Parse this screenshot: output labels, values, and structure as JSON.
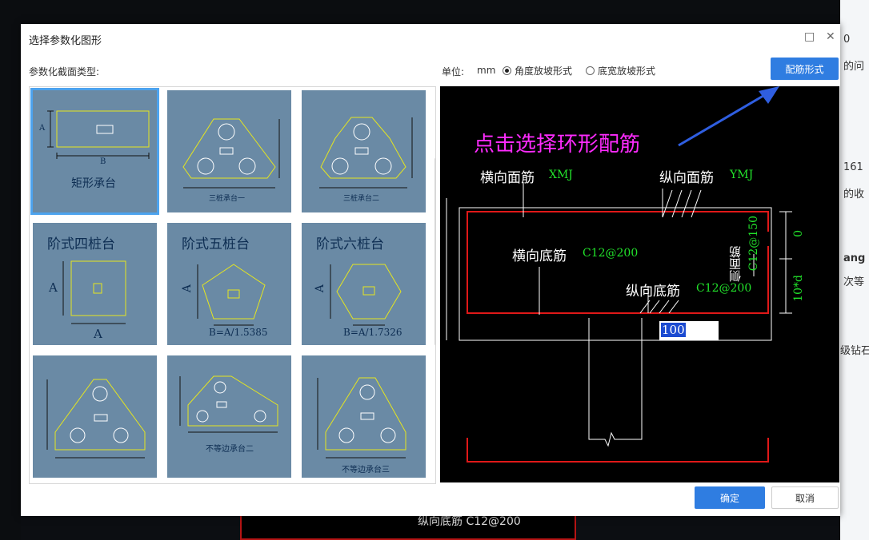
{
  "background": {
    "right_texts": [
      "0",
      "的问",
      "161",
      "的收",
      "ang",
      "次等",
      "级钻石"
    ],
    "cad_text": "纵向底筋 C12@200"
  },
  "dialog": {
    "title": "选择参数化图形",
    "section_label": "参数化截面类型:",
    "unit_label": "单位:",
    "unit_value": "mm",
    "radio_angle": "角度放坡形式",
    "radio_width": "底宽放坡形式",
    "rebar_button": "配筋形式",
    "ok_button": "确定",
    "cancel_button": "取消"
  },
  "gallery": [
    {
      "label": "矩形承台",
      "dim_a": "A",
      "dim_b": "B",
      "selected": true
    },
    {
      "label": "三桩承台一"
    },
    {
      "label": "三桩承台二"
    },
    {
      "label": "阶式四桩台",
      "dim_a": "A",
      "dim_b": "A"
    },
    {
      "label": "阶式五桩台",
      "dim_a": "A",
      "formula": "B=A/1.5385"
    },
    {
      "label": "阶式六桩台",
      "dim_a": "A",
      "formula": "B=A/1.7326"
    },
    {
      "label": ""
    },
    {
      "label": "不等边承台二"
    },
    {
      "label": "不等边承台三"
    }
  ],
  "preview": {
    "instruction": "点击选择环形配筋",
    "top_transverse": "横向面筋",
    "top_transverse_value": "XMJ",
    "top_longitudinal": "纵向面筋",
    "top_longitudinal_value": "YMJ",
    "bottom_transverse": "横向底筋",
    "bottom_transverse_value": "C12@200",
    "bottom_longitudinal": "纵向底筋",
    "bottom_longitudinal_value": "C12@200",
    "side_label": "侧面筋",
    "side_value": "C12@150",
    "dim_zero": "0",
    "dim_10d": "10*d",
    "input_value": "100"
  },
  "colors": {
    "accent": "#2f7de1",
    "instruction": "#ff2bff",
    "value": "#22e22b",
    "rebar": "#e01818",
    "cell_bg": "#6a8aa5",
    "cell_line": "#e6e61e"
  }
}
